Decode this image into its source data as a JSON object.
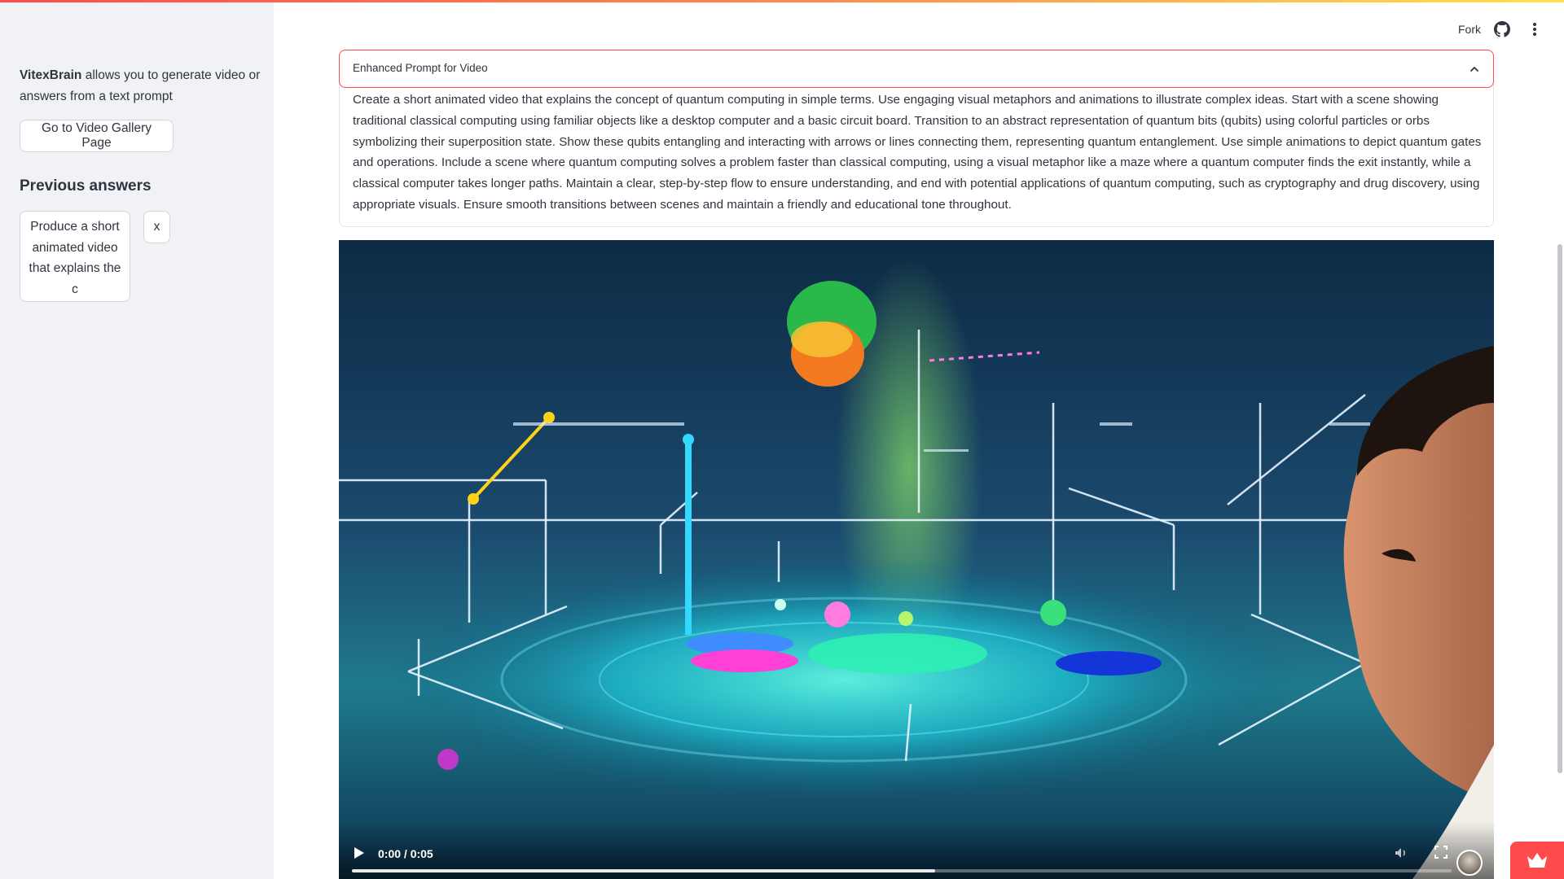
{
  "sidebar": {
    "brand": "VitexBrain",
    "description_rest": " allows you to generate video or answers from a text prompt",
    "gallery_button": "Go to Video Gallery Page",
    "previous_title": "Previous answers",
    "previous_items": [
      {
        "label": "Produce a short animated video that explains the c",
        "delete_label": "x"
      }
    ]
  },
  "header": {
    "fork_label": "Fork",
    "github_icon": "github-icon",
    "menu_icon": "more-vertical-icon"
  },
  "expander": {
    "title": "Enhanced Prompt for Video",
    "chevron_icon": "chevron-up-icon",
    "body": "Create a short animated video that explains the concept of quantum computing in simple terms. Use engaging visual metaphors and animations to illustrate complex ideas. Start with a scene showing traditional classical computing using familiar objects like a desktop computer and a basic circuit board. Transition to an abstract representation of quantum bits (qubits) using colorful particles or orbs symbolizing their superposition state. Show these qubits entangling and interacting with arrows or lines connecting them, representing quantum entanglement. Use simple animations to depict quantum gates and operations. Include a scene where quantum computing solves a problem faster than classical computing, using a visual metaphor like a maze where a quantum computer finds the exit instantly, while a classical computer takes longer paths. Maintain a clear, step-by-step flow to ensure understanding, and end with potential applications of quantum computing, such as cryptography and drug discovery, using appropriate visuals. Ensure smooth transitions between scenes and maintain a friendly and educational tone throughout."
  },
  "video": {
    "time_display": "0:00 / 0:05",
    "progress_fraction": 0.53,
    "play_icon": "play-icon",
    "volume_icon": "volume-icon",
    "fullscreen_icon": "fullscreen-icon"
  },
  "colors": {
    "accent": "#ff4b4b",
    "sidebar_bg": "#f0f2f6",
    "text": "#31333f"
  }
}
